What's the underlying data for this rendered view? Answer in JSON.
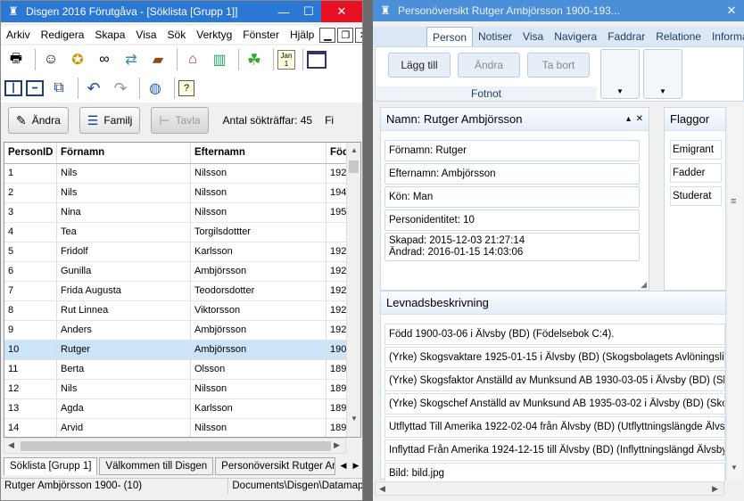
{
  "left": {
    "title": "Disgen 2016 Förutgåva - [Söklista [Grupp 1]]",
    "window_controls": {
      "minimize": "—",
      "maximize": "☐",
      "close": "✕"
    },
    "menu": [
      "Arkiv",
      "Redigera",
      "Skapa",
      "Visa",
      "Sök",
      "Verktyg",
      "Fönster",
      "Hjälp"
    ],
    "mdi_controls": {
      "minimize": "▁",
      "restore": "❐",
      "close": "✕"
    },
    "toolbar1_icons": [
      "printer-icon",
      "person-icon",
      "person-star-icon",
      "binoculars-icon",
      "signpost-icon",
      "book-icon",
      "home-icon",
      "books-icon",
      "map-icon",
      "calendar-icon",
      "window-icon"
    ],
    "calendar_label": "Jan\n1",
    "toolbar2_icons": [
      "split-vertical-icon",
      "split-horizontal-icon",
      "cascade-icon",
      "undo-icon",
      "redo-icon",
      "globe-icon",
      "help-icon"
    ],
    "help_label": "?",
    "buttons": {
      "edit": "Ändra",
      "family": "Familj",
      "tree": "Tavla"
    },
    "hit_count_label": "Antal sökträffar:",
    "hit_count": "45",
    "hit_tail": "Fi",
    "columns": [
      "PersonID",
      "Förnamn",
      "Efternamn",
      "Föd"
    ],
    "rows": [
      {
        "id": "1",
        "first": "Nils",
        "last": "Nilsson",
        "born": "192"
      },
      {
        "id": "2",
        "first": "Nils",
        "last": "Nilsson",
        "born": "194"
      },
      {
        "id": "3",
        "first": "Nina",
        "last": "Nilsson",
        "born": "195"
      },
      {
        "id": "4",
        "first": "Tea",
        "last": "Torgilsdottter",
        "born": ""
      },
      {
        "id": "5",
        "first": "Fridolf",
        "last": "Karlsson",
        "born": "192"
      },
      {
        "id": "6",
        "first": "Gunilla",
        "last": "Ambjörsson",
        "born": "192"
      },
      {
        "id": "7",
        "first": "Frida Augusta",
        "last": "Teodorsdotter",
        "born": "192"
      },
      {
        "id": "8",
        "first": "Rut Linnea",
        "last": "Viktorsson",
        "born": "192"
      },
      {
        "id": "9",
        "first": "Anders",
        "last": "Ambjörsson",
        "born": "192"
      },
      {
        "id": "10",
        "first": "Rutger",
        "last": "Ambjörsson",
        "born": "190"
      },
      {
        "id": "11",
        "first": "Berta",
        "last": "Olsson",
        "born": "189"
      },
      {
        "id": "12",
        "first": "Nils",
        "last": "Nilsson",
        "born": "189"
      },
      {
        "id": "13",
        "first": "Agda",
        "last": "Karlsson",
        "born": "189"
      },
      {
        "id": "14",
        "first": "Arvid",
        "last": "Nilsson",
        "born": "189"
      }
    ],
    "selected_row": 9,
    "tabs": [
      "Söklista [Grupp 1]",
      "Välkommen till Disgen",
      "Personöversikt Rutger Ambjörsson"
    ],
    "tab_arrows": {
      "left": "◀",
      "right": "▶"
    },
    "status": {
      "person": "Rutger Ambjörsson 1900- (10)",
      "path": "Documents\\Disgen\\Datamapp"
    }
  },
  "right": {
    "title": "Personöversikt Rutger Ambjörsson 1900-193...",
    "close": "✕",
    "ribbon_tabs": [
      "Person",
      "Notiser",
      "Visa",
      "Navigera",
      "Faddrar",
      "Relatione",
      "Informati"
    ],
    "ribbon_buttons": {
      "add": "Lägg till",
      "edit": "Ändra",
      "remove": "Ta bort"
    },
    "ribbon_group": "Fotnot",
    "dropdown_arrow": "▼",
    "name_panel": {
      "title": "Namn: Rutger Ambjörsson",
      "pin": "▴",
      "close": "✕",
      "first": "Förnamn: Rutger",
      "last": "Efternamn: Ambjörsson",
      "sex": "Kön: Man",
      "pid": "Personidentitet: 10",
      "created": "Skapad: 2015-12-03 21:27:14",
      "changed": "Ändrad: 2016-01-15 14:03:06"
    },
    "flags_panel": {
      "title": "Flaggor",
      "items": [
        "Emigrant",
        "Fadder",
        "Studerat"
      ]
    },
    "life_panel": {
      "title": "Levnadsbeskrivning",
      "items": [
        "Född 1900-03-06 i Älvsby (BD) (Födelsebok C:4).",
        "(Yrke) Skogsvaktare 1925-01-15 i Älvsby (BD) (Skogsbolagets Avlöningslistor)",
        "(Yrke) Skogsfaktor Anställd av Munksund AB 1930-03-05 i Älvsby (BD) (Skogsb",
        "(Yrke) Skogschef Anställd av Munksund AB 1935-03-02 i Älvsby (BD) (Skogsbo",
        "Utflyttad Till Amerika 1922-02-04 från Älvsby (BD) (Utflyttningslängde Älvsby)",
        "Inflyttad Från Amerika 1924-12-15 till Älvsby (BD) (Inflyttningslängd Älvsby).",
        "Bild: bild.jpg"
      ]
    },
    "scroll_arrows": {
      "left": "◀",
      "right": "▶",
      "up": "▲",
      "down": "▼"
    },
    "splitter": "≡",
    "resize_grip": "◢"
  }
}
